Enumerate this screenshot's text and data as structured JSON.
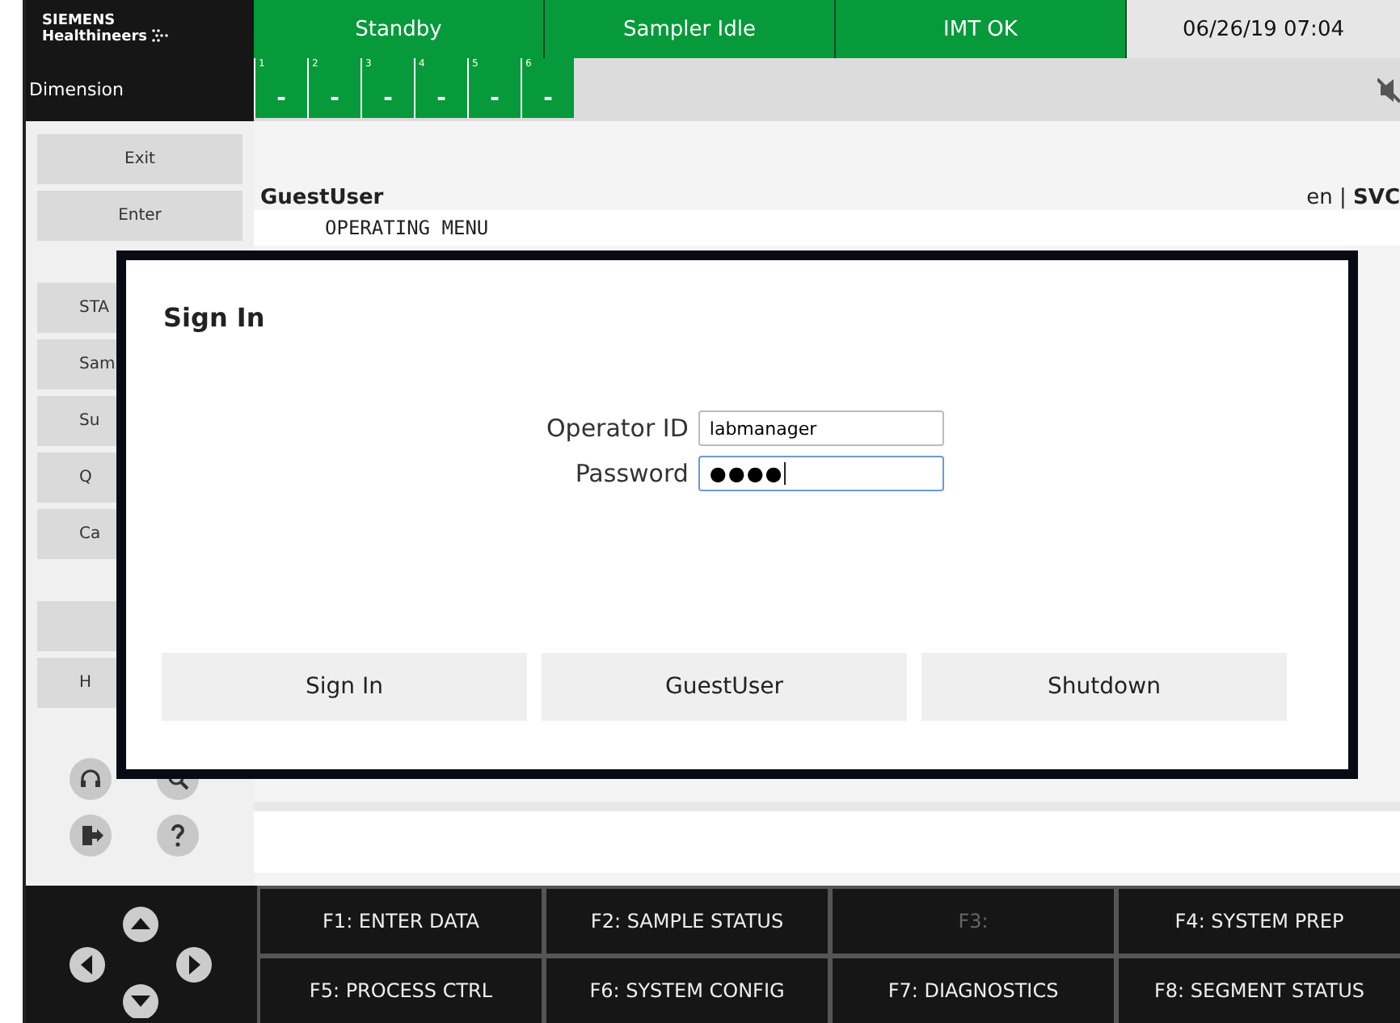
{
  "header": {
    "brand": [
      "SIEMENS",
      "Healthineers"
    ],
    "product": "Dimension",
    "statuses": [
      "Standby",
      "Sampler Idle",
      "IMT OK"
    ],
    "datetime": "06/26/19 07:04",
    "segments": [
      {
        "number": "1",
        "value": "-"
      },
      {
        "number": "2",
        "value": "-"
      },
      {
        "number": "3",
        "value": "-"
      },
      {
        "number": "4",
        "value": "-"
      },
      {
        "number": "5",
        "value": "-"
      },
      {
        "number": "6",
        "value": "-"
      }
    ]
  },
  "sidebar": {
    "top_buttons": [
      "Exit",
      "Enter"
    ],
    "menu_buttons": [
      "STA",
      "Sam",
      "Su",
      "Q",
      "Ca"
    ],
    "lower_buttons": [
      {
        "kind": "blank"
      },
      {
        "kind": "labeled",
        "label": "H"
      }
    ]
  },
  "main": {
    "user": "GuestUser",
    "language": "en",
    "separator": "|",
    "mode": "SVC",
    "menu_title": "OPERATING MENU"
  },
  "dialog": {
    "title": "Sign In",
    "fields": [
      {
        "label": "Operator ID",
        "value": "labmanager",
        "kind": "text",
        "focused": false
      },
      {
        "label": "Password",
        "value": "●●●●",
        "kind": "password",
        "focused": true
      }
    ],
    "buttons": [
      "Sign In",
      "GuestUser",
      "Shutdown"
    ]
  },
  "function_keys": [
    {
      "label": "F1: ENTER DATA",
      "disabled": false
    },
    {
      "label": "F2: SAMPLE STATUS",
      "disabled": false
    },
    {
      "label": "F3:",
      "disabled": true
    },
    {
      "label": "F4: SYSTEM PREP",
      "disabled": false
    },
    {
      "label": "F5: PROCESS CTRL",
      "disabled": false
    },
    {
      "label": "F6: SYSTEM CONFIG",
      "disabled": false
    },
    {
      "label": "F7: DIAGNOSTICS",
      "disabled": false
    },
    {
      "label": "F8: SEGMENT STATUS",
      "disabled": false
    }
  ]
}
